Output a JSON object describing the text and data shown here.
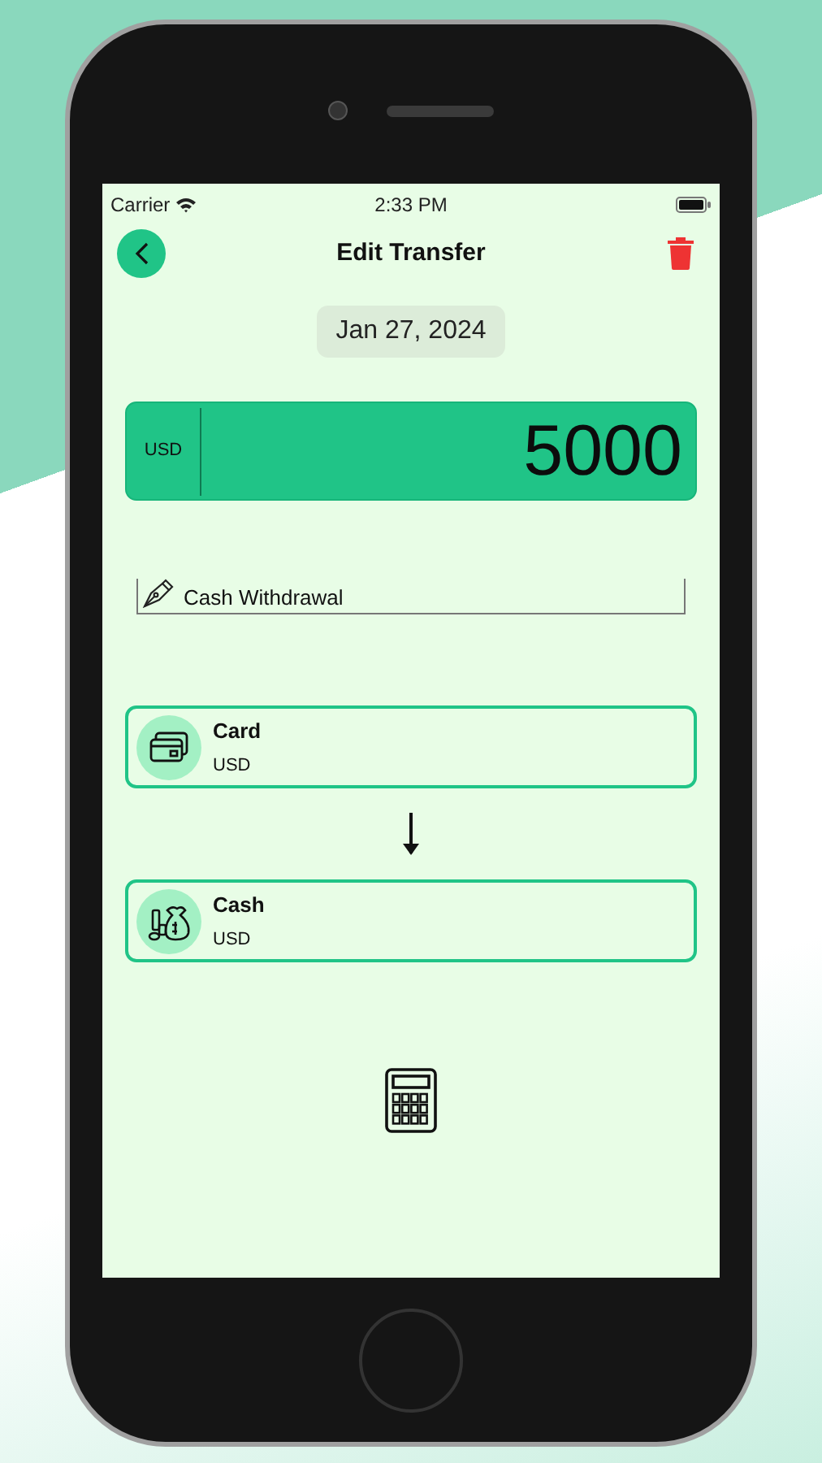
{
  "status_bar": {
    "carrier": "Carrier",
    "time": "2:33 PM"
  },
  "header": {
    "title": "Edit Transfer"
  },
  "date": "Jan 27, 2024",
  "amount": {
    "currency": "USD",
    "value": "5000"
  },
  "note": {
    "value": "Cash Withdrawal"
  },
  "accounts": [
    {
      "kind": "card",
      "name": "Card",
      "currency": "USD"
    },
    {
      "kind": "cash",
      "name": "Cash",
      "currency": "USD"
    }
  ]
}
